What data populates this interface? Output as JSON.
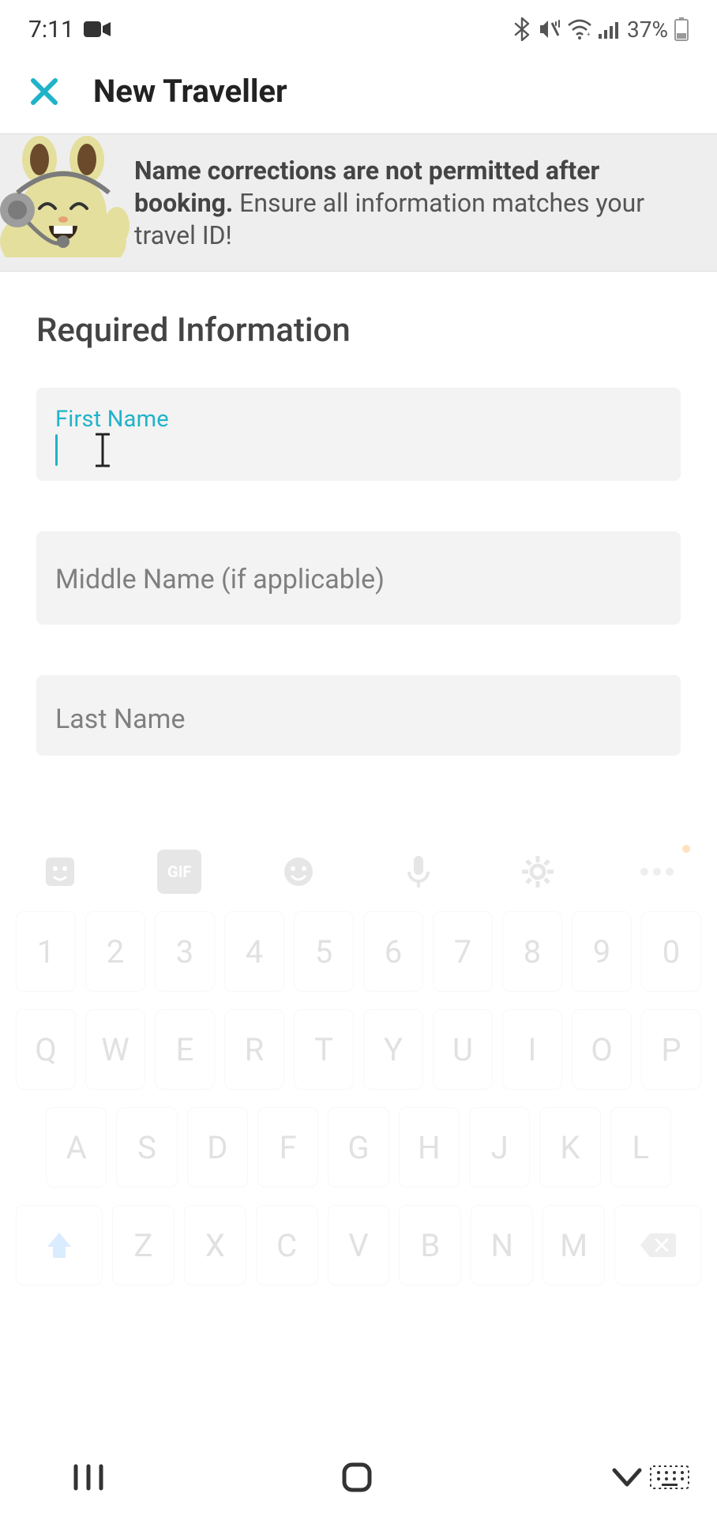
{
  "status": {
    "time": "7:11",
    "battery_text": "37%"
  },
  "header": {
    "title": "New Traveller"
  },
  "banner": {
    "bold": "Name corrections are not permitted after booking.",
    "rest": " Ensure all information matches your travel ID!"
  },
  "section": {
    "title": "Required Information"
  },
  "fields": {
    "first": {
      "label": "First Name",
      "value": ""
    },
    "middle": {
      "placeholder": "Middle Name (if applicable)",
      "value": ""
    },
    "last": {
      "placeholder": "Last Name",
      "value": ""
    }
  },
  "keyboard": {
    "gif_label": "GIF",
    "row_num": [
      "1",
      "2",
      "3",
      "4",
      "5",
      "6",
      "7",
      "8",
      "9",
      "0"
    ],
    "row_q": [
      "Q",
      "W",
      "E",
      "R",
      "T",
      "Y",
      "U",
      "I",
      "O",
      "P"
    ],
    "row_a": [
      "A",
      "S",
      "D",
      "F",
      "G",
      "H",
      "J",
      "K",
      "L"
    ],
    "row_z": [
      "Z",
      "X",
      "C",
      "V",
      "B",
      "N",
      "M"
    ]
  },
  "colors": {
    "accent": "#1fb3c9"
  }
}
